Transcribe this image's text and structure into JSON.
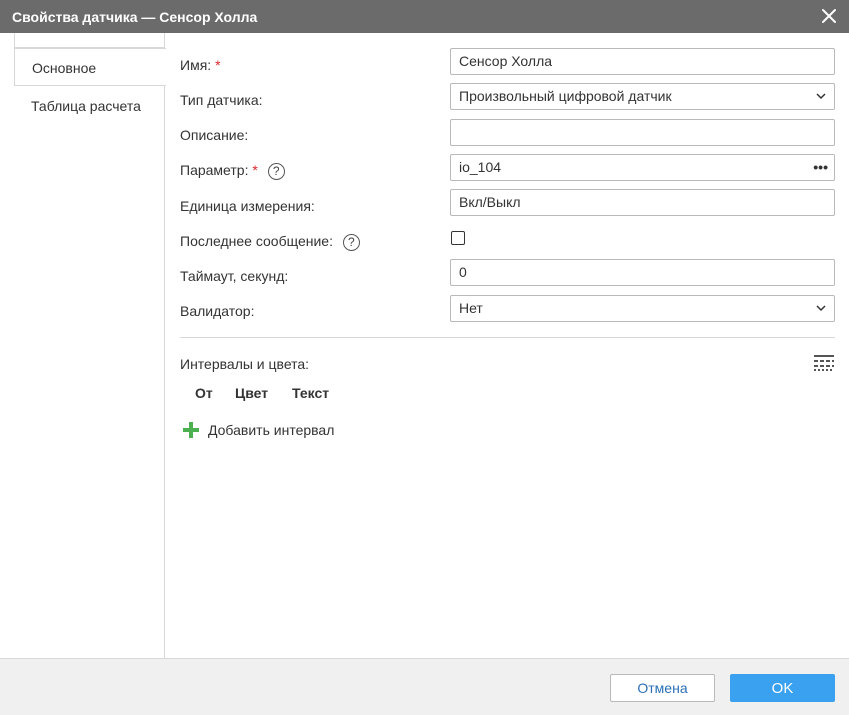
{
  "dialog": {
    "title": "Свойства датчика — Сенсор Холла"
  },
  "tabs": [
    {
      "label": "Основное",
      "active": true
    },
    {
      "label": "Таблица расчета",
      "active": false
    }
  ],
  "form": {
    "name": {
      "label": "Имя:",
      "required_mark": "*",
      "value": "Сенсор Холла"
    },
    "sensor_type": {
      "label": "Тип датчика:",
      "value": "Произвольный цифровой датчик"
    },
    "description": {
      "label": "Описание:",
      "value": ""
    },
    "parameter": {
      "label": "Параметр:",
      "required_mark": "*",
      "help": "?",
      "value": "io_104",
      "more": "•••"
    },
    "unit": {
      "label": "Единица измерения:",
      "value": "Вкл/Выкл"
    },
    "last_message": {
      "label": "Последнее сообщение:",
      "help": "?",
      "checked": false
    },
    "timeout": {
      "label": "Таймаут, секунд:",
      "value": "0"
    },
    "validator": {
      "label": "Валидатор:",
      "value": "Нет"
    }
  },
  "intervals": {
    "title": "Интервалы и цвета:",
    "columns": [
      "От",
      "Цвет",
      "Текст"
    ],
    "add_label": "Добавить интервал"
  },
  "footer": {
    "cancel_label": "Отмена",
    "ok_label": "OK"
  },
  "colors": {
    "titlebar": "#6b6b6b",
    "required": "#d9262c",
    "add_icon": "#4caf50",
    "ok_button": "#3aa0f0",
    "cancel_text": "#2a6fb6"
  }
}
